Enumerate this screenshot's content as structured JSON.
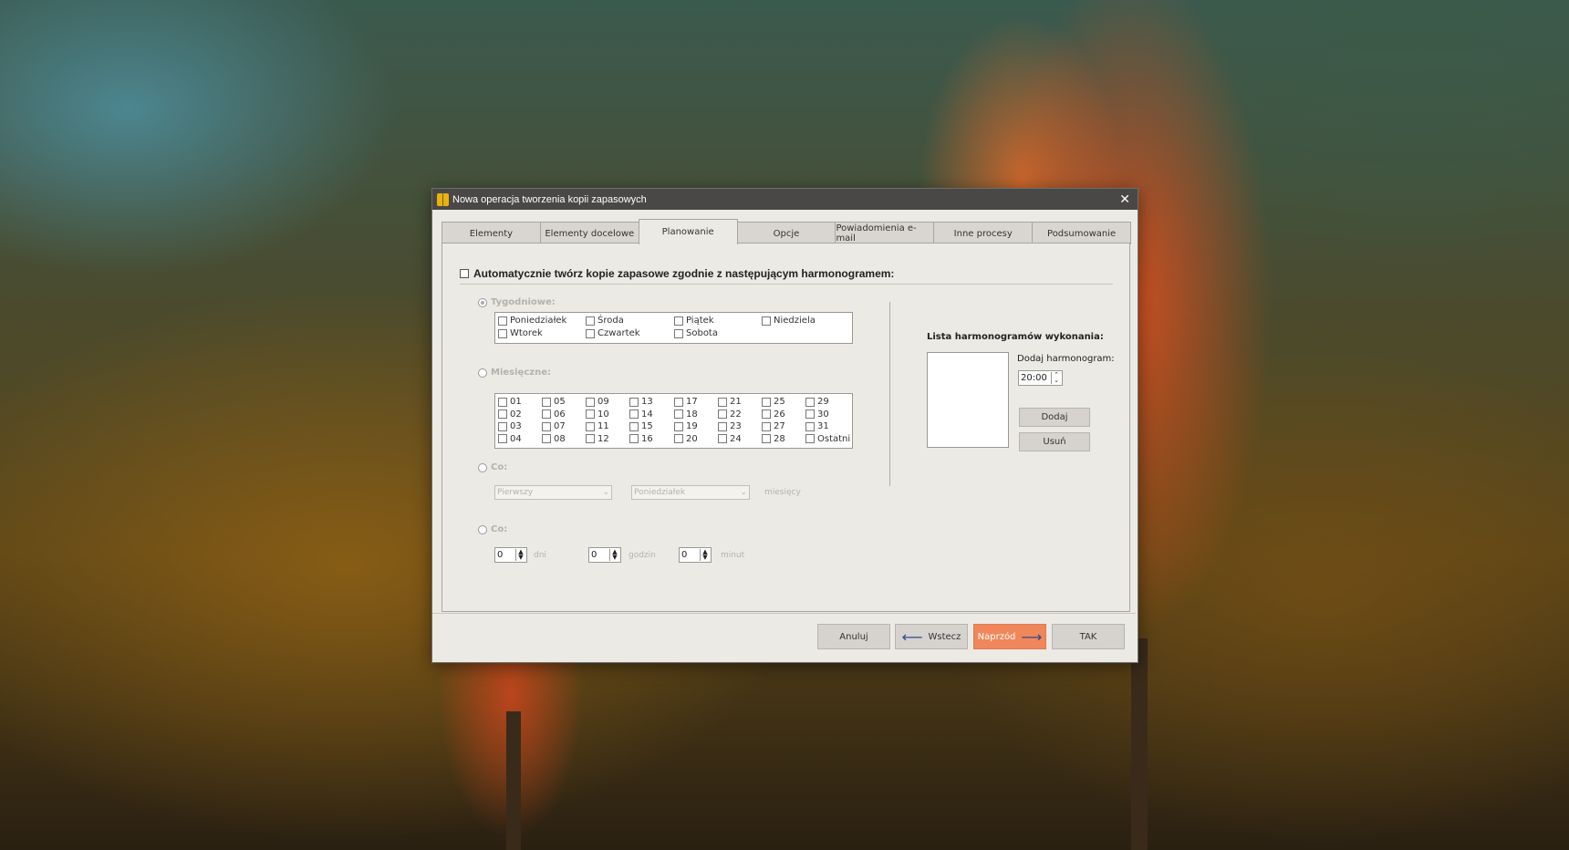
{
  "window": {
    "title": "Nowa operacja tworzenia kopii zapasowych",
    "close": "✕"
  },
  "tabs": [
    {
      "label": "Elementy",
      "active": false
    },
    {
      "label": "Elementy docelowe",
      "active": false
    },
    {
      "label": "Planowanie",
      "active": true
    },
    {
      "label": "Opcje",
      "active": false
    },
    {
      "label": "Powiadomienia e-mail",
      "active": false
    },
    {
      "label": "Inne procesy",
      "active": false
    },
    {
      "label": "Podsumowanie",
      "active": false
    }
  ],
  "auto_schedule": {
    "label": "Automatycznie twórz kopie zapasowe zgodnie z następującym harmonogramem:",
    "checked": false
  },
  "weekly": {
    "label": "Tygodniowe:",
    "days": [
      "Poniedziałek",
      "Środa",
      "Piątek",
      "Niedziela",
      "Wtorek",
      "Czwartek",
      "Sobota"
    ]
  },
  "monthly": {
    "label": "Miesięczne:",
    "days": [
      "01",
      "05",
      "09",
      "13",
      "17",
      "21",
      "25",
      "29",
      "02",
      "06",
      "10",
      "14",
      "18",
      "22",
      "26",
      "30",
      "03",
      "07",
      "11",
      "15",
      "19",
      "23",
      "27",
      "31",
      "04",
      "08",
      "12",
      "16",
      "20",
      "24",
      "28",
      "Ostatni"
    ]
  },
  "every_relative": {
    "label": "Co:",
    "first_combo": "Pierwszy",
    "day_combo": "Poniedziałek",
    "suffix": "miesięcy"
  },
  "every_interval": {
    "label": "Co:",
    "days_value": "0",
    "days_unit": "dni",
    "hours_value": "0",
    "hours_unit": "godzin",
    "minutes_value": "0",
    "minutes_unit": "minut"
  },
  "schedule_list": {
    "title": "Lista harmonogramów wykonania:",
    "add_label": "Dodaj harmonogram:",
    "time_value": "20:00",
    "add_button": "Dodaj",
    "remove_button": "Usuń"
  },
  "footer": {
    "cancel": "Anuluj",
    "back": "Wstecz",
    "next": "Naprzód",
    "ok": "TAK"
  },
  "colors": {
    "accent": "#f0875a",
    "titlebar": "#4a4846",
    "dialog_bg": "#eceae5"
  }
}
